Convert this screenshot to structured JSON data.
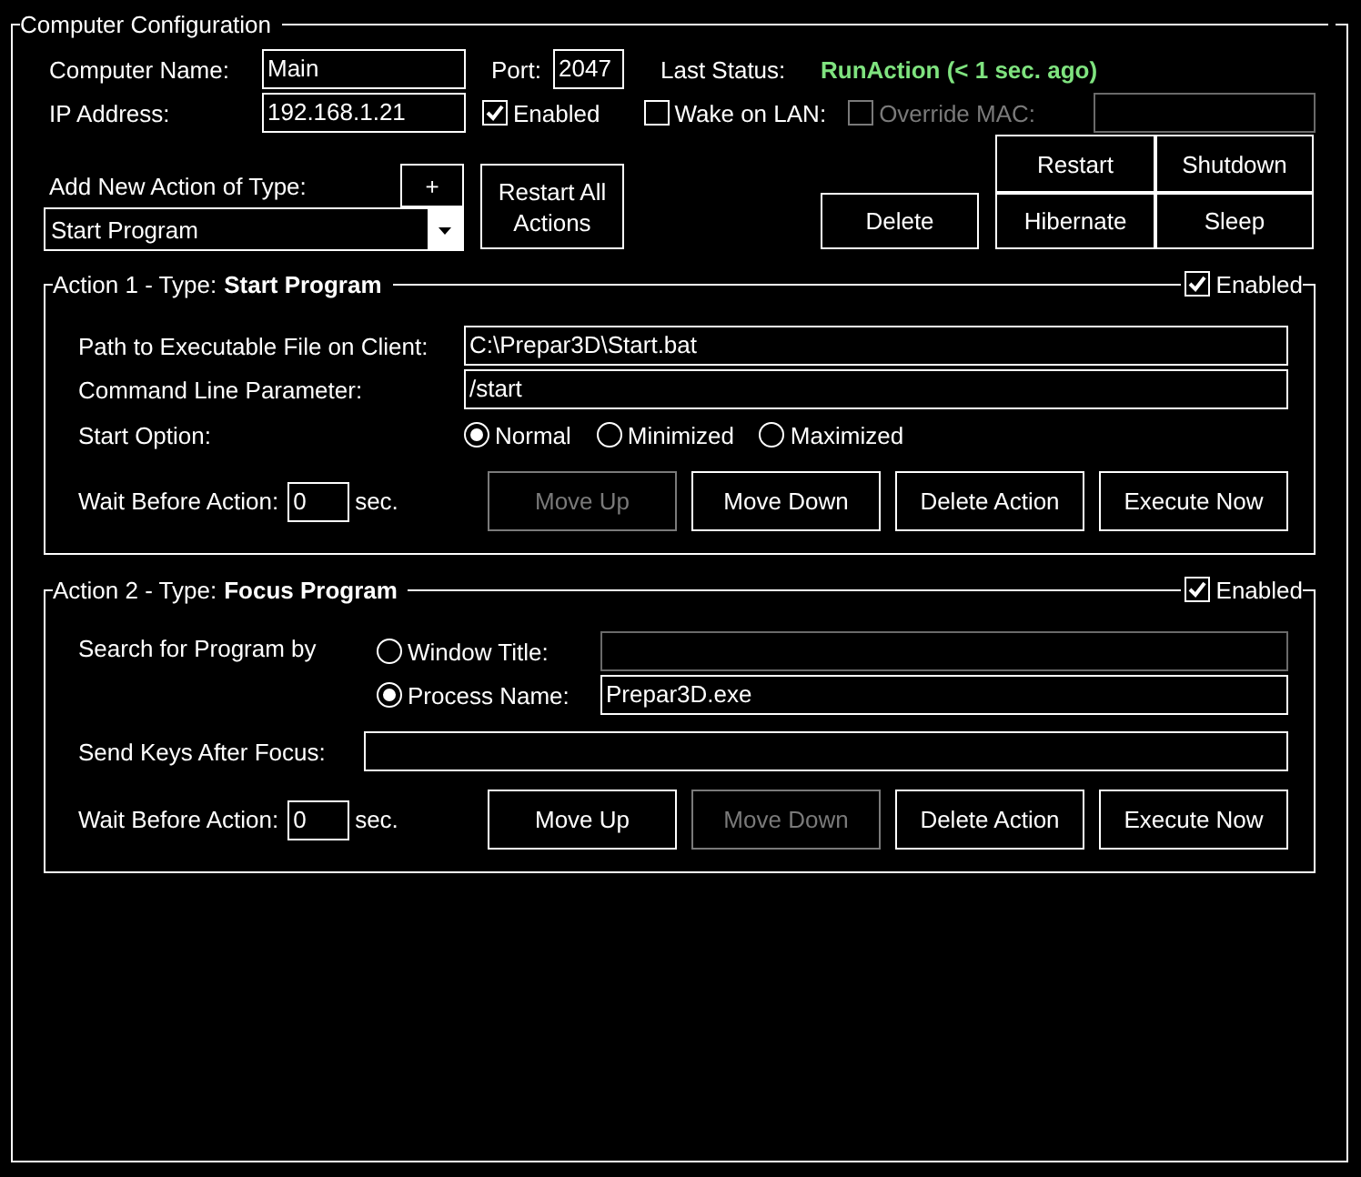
{
  "configuration": {
    "title": "Computer Configuration",
    "computer_name": {
      "label": "Computer Name:",
      "value": "Main"
    },
    "port": {
      "label": "Port:",
      "value": "2047"
    },
    "last_status": {
      "label": "Last Status:",
      "value": "RunAction (< 1 sec. ago)"
    },
    "ip_address": {
      "label": "IP Address:",
      "value": "192.168.1.21"
    },
    "enabled": {
      "label": "Enabled",
      "checked": true
    },
    "wake_on_lan": {
      "label": "Wake on LAN:",
      "checked": false
    },
    "override_mac": {
      "label": "Override MAC:",
      "checked": false,
      "disabled": true
    },
    "add_action": {
      "label": "Add New Action of Type:",
      "add_button": "+",
      "type": "Start Program"
    },
    "restart_all_button": "Restart All Actions",
    "delete_button": "Delete",
    "power_buttons": [
      "Restart",
      "Shutdown",
      "Hibernate",
      "Sleep"
    ]
  },
  "actions": [
    {
      "kind": "start_program",
      "title": "Action 1 - Type:",
      "type": "Start Program",
      "enabled": {
        "label": "Enabled",
        "checked": true
      },
      "rows": [
        {
          "kind": "field",
          "label": "Path to Executable File on Client:",
          "value": "C:\\Prepar3D\\Start.bat"
        },
        {
          "kind": "field",
          "label": "Command Line Parameter:",
          "value": "/start"
        },
        {
          "kind": "radios",
          "label": "Start Option:",
          "options": [
            {
              "label": "Normal",
              "selected": true
            },
            {
              "label": "Minimized",
              "selected": false
            },
            {
              "label": "Maximized",
              "selected": false
            }
          ]
        }
      ],
      "wait": {
        "label": "Wait Before Action:",
        "value": "0",
        "unit": "sec."
      },
      "buttons": [
        {
          "label": "Move Up",
          "disabled": true
        },
        {
          "label": "Move Down",
          "disabled": false
        },
        {
          "label": "Delete Action",
          "disabled": false
        },
        {
          "label": "Execute Now",
          "disabled": false
        }
      ]
    },
    {
      "kind": "focus_program",
      "title": "Action 2 - Type:",
      "type": "Focus Program",
      "enabled": {
        "label": "Enabled",
        "checked": true
      },
      "rows": [
        {
          "kind": "choice",
          "label": "Search for Program by",
          "options": [
            {
              "label": "Window Title:",
              "selected": false
            },
            {
              "label": "Process Name:",
              "selected": true,
              "value": "Prepar3D.exe"
            }
          ]
        },
        {
          "kind": "field",
          "label": "Send Keys After Focus:"
        }
      ],
      "wait": {
        "label": "Wait Before Action:",
        "value": "0",
        "unit": "sec."
      },
      "buttons": [
        {
          "label": "Move Up",
          "disabled": false
        },
        {
          "label": "Move Down",
          "disabled": true
        },
        {
          "label": "Delete Action",
          "disabled": false
        },
        {
          "label": "Execute Now",
          "disabled": false
        }
      ]
    }
  ]
}
